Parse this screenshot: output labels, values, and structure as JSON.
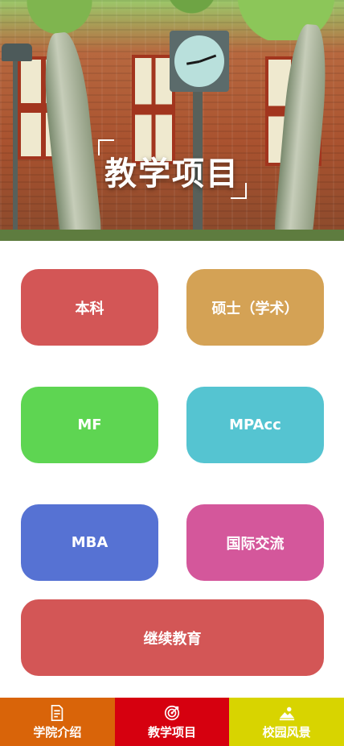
{
  "hero": {
    "title": "教学项目"
  },
  "programs": [
    {
      "label": "本科",
      "color": "#d35656"
    },
    {
      "label": "硕士（学术）",
      "color": "#d4a255"
    },
    {
      "label": "MF",
      "color": "#5ed552"
    },
    {
      "label": "MPAcc",
      "color": "#55c4d1"
    },
    {
      "label": "MBA",
      "color": "#5672d3"
    },
    {
      "label": "国际交流",
      "color": "#d4579b"
    },
    {
      "label": "继续教育",
      "color": "#d35656"
    }
  ],
  "tabbar": {
    "items": [
      {
        "label": "学院介绍",
        "icon": "document-icon",
        "color": "#d96409"
      },
      {
        "label": "教学项目",
        "icon": "target-icon",
        "color": "#d6000f",
        "active": true
      },
      {
        "label": "校园风景",
        "icon": "landscape-icon",
        "color": "#d8d400"
      }
    ]
  }
}
